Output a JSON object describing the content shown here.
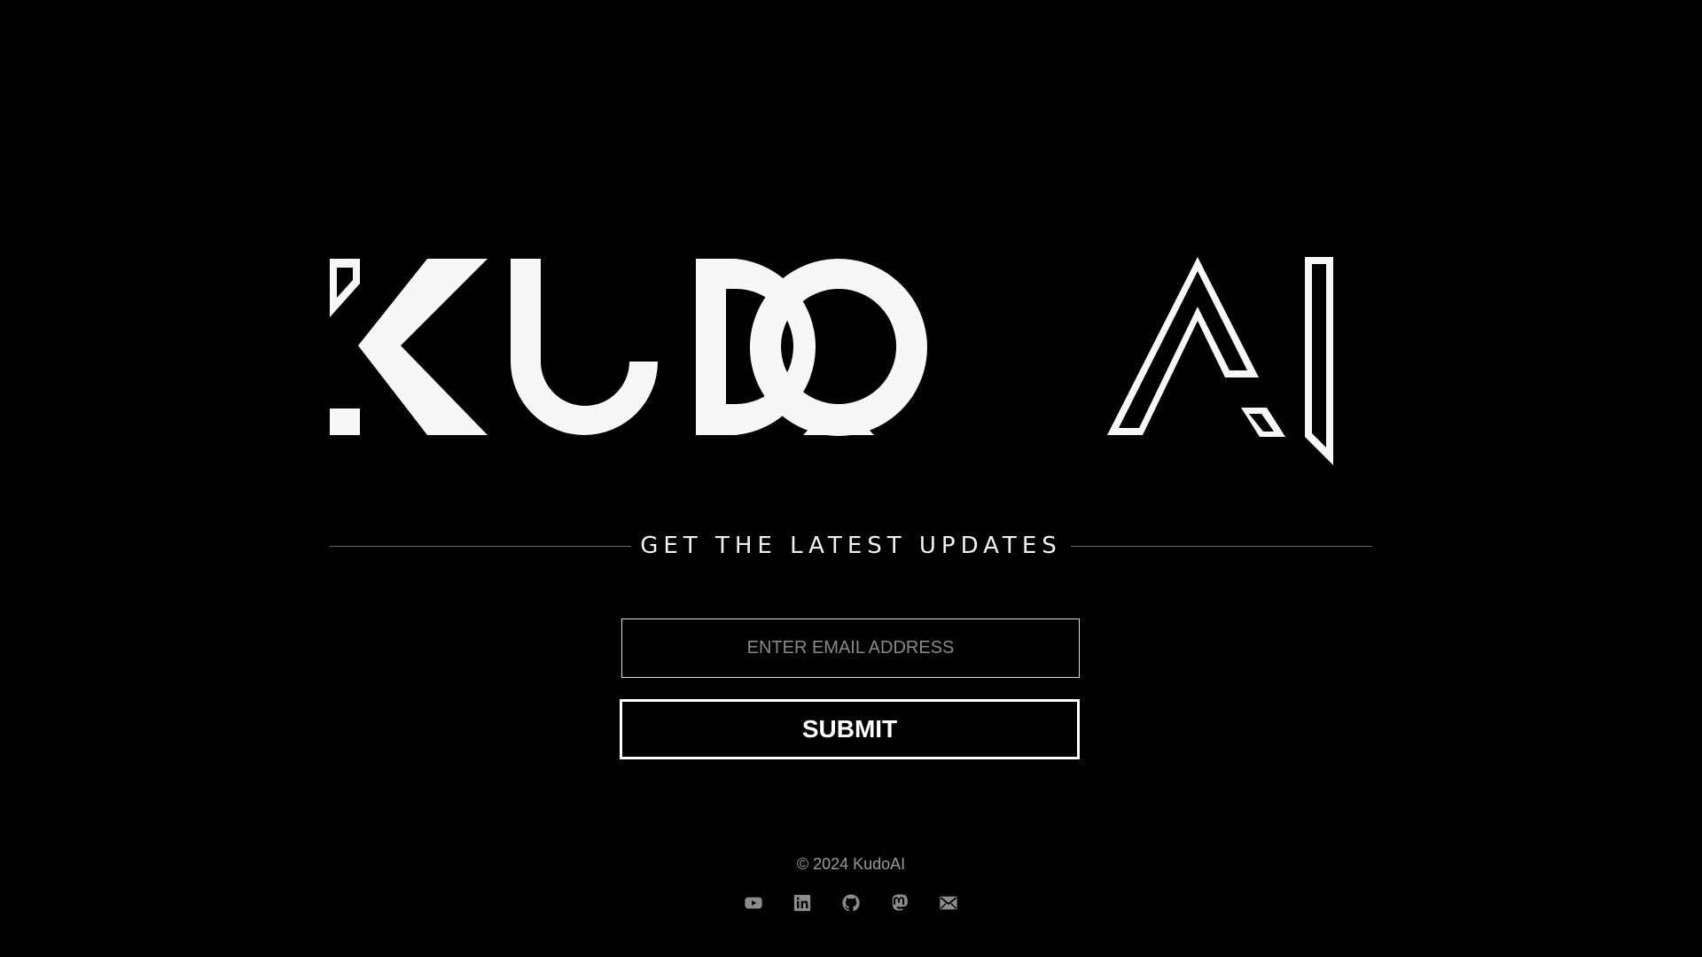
{
  "brand": {
    "logo_text": "KUDOAI"
  },
  "newsletter": {
    "heading": "GET THE LATEST UPDATES",
    "email_placeholder": "ENTER EMAIL ADDRESS",
    "email_value": "",
    "submit_label": "SUBMIT"
  },
  "footer": {
    "copyright": "© 2024 KudoAI",
    "social_links": [
      {
        "icon": "youtube-icon"
      },
      {
        "icon": "linkedin-icon"
      },
      {
        "icon": "github-icon"
      },
      {
        "icon": "mastodon-icon"
      },
      {
        "icon": "email-icon"
      }
    ]
  },
  "colors": {
    "background": "#000000",
    "foreground": "#ffffff",
    "muted": "#9a9a9a",
    "icon": "#8c8c8c"
  }
}
